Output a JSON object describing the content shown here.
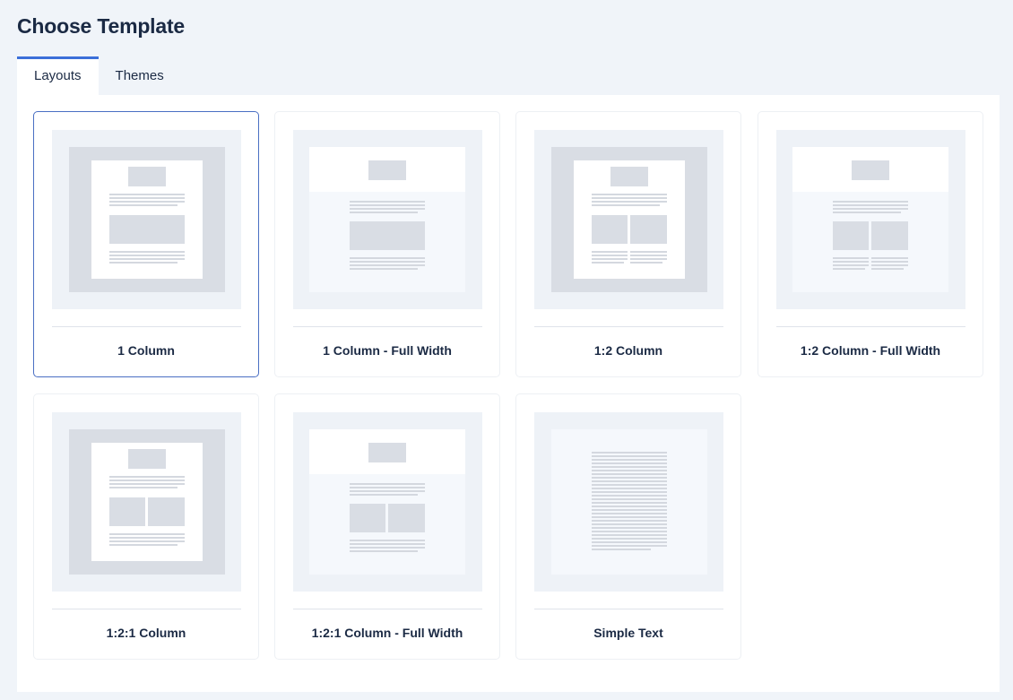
{
  "page": {
    "title": "Choose Template"
  },
  "tabs": [
    {
      "label": "Layouts",
      "active": true
    },
    {
      "label": "Themes",
      "active": false
    }
  ],
  "templates": [
    {
      "label": "1 Column",
      "selected": true
    },
    {
      "label": "1 Column - Full Width",
      "selected": false
    },
    {
      "label": "1:2 Column",
      "selected": false
    },
    {
      "label": "1:2 Column - Full Width",
      "selected": false
    },
    {
      "label": "1:2:1 Column",
      "selected": false
    },
    {
      "label": "1:2:1 Column - Full Width",
      "selected": false
    },
    {
      "label": "Simple Text",
      "selected": false
    }
  ],
  "colors": {
    "accent": "#3b6fd9",
    "selected_border": "#4a6fc3",
    "text": "#1b2a44",
    "background": "#f0f4f9"
  }
}
